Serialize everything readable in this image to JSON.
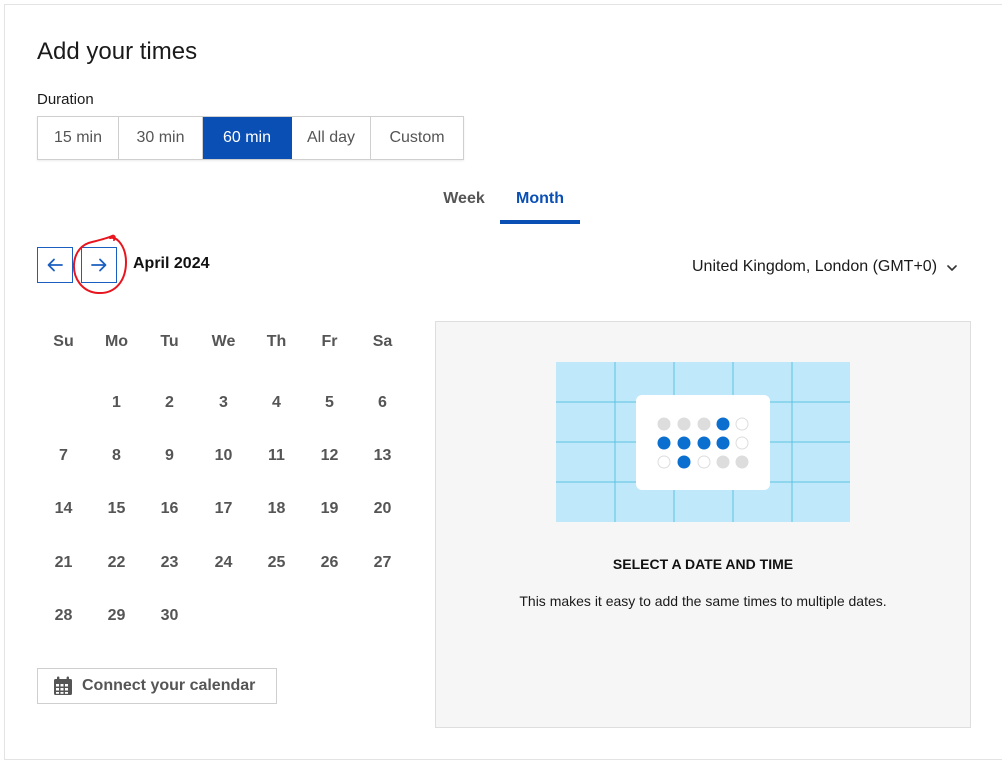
{
  "header": {
    "title": "Add your times"
  },
  "duration": {
    "label": "Duration",
    "options": [
      "15 min",
      "30 min",
      "60 min",
      "All day",
      "Custom"
    ],
    "selected": "60 min"
  },
  "view_tabs": {
    "week": "Week",
    "month": "Month",
    "selected": "Month"
  },
  "calendar": {
    "month_label": "April 2024",
    "weekdays": [
      "Su",
      "Mo",
      "Tu",
      "We",
      "Th",
      "Fr",
      "Sa"
    ],
    "weeks": [
      [
        "",
        "1",
        "2",
        "3",
        "4",
        "5",
        "6"
      ],
      [
        "7",
        "8",
        "9",
        "10",
        "11",
        "12",
        "13"
      ],
      [
        "14",
        "15",
        "16",
        "17",
        "18",
        "19",
        "20"
      ],
      [
        "21",
        "22",
        "23",
        "24",
        "25",
        "26",
        "27"
      ],
      [
        "28",
        "29",
        "30",
        "",
        "",
        "",
        ""
      ]
    ],
    "prev_icon": "arrow-left-icon",
    "next_icon": "arrow-right-icon"
  },
  "timezone": {
    "label": "United Kingdom, London (GMT+0)",
    "icon": "chevron-down-icon"
  },
  "connect_calendar": {
    "label": "Connect your calendar",
    "icon": "calendar-icon"
  },
  "info": {
    "title": "SELECT A DATE AND TIME",
    "text": "This makes it easy to add the same times to multiple dates."
  },
  "colors": {
    "accent": "#0a4fb4",
    "illustration_bg": "#bfe8fa",
    "illustration_grid": "#5cc3e0",
    "annotation": "#e8141e"
  }
}
